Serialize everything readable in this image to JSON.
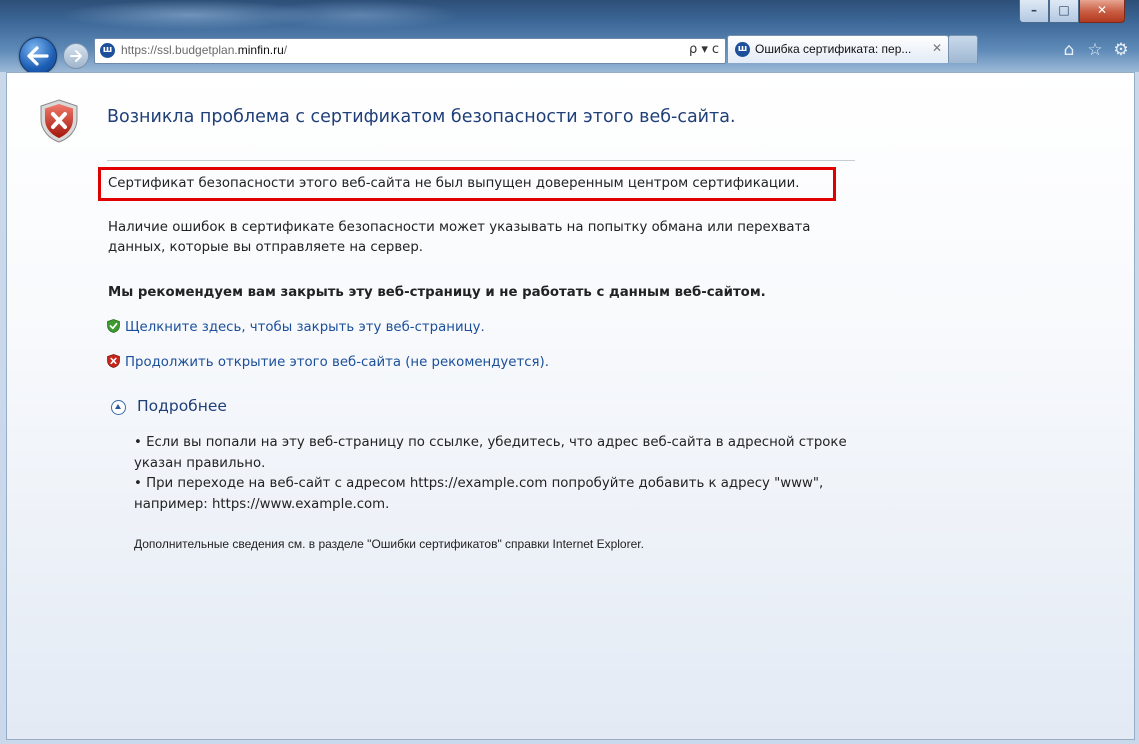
{
  "window": {
    "controls": {
      "minimize": "–",
      "maximize": "□",
      "close": "✕"
    }
  },
  "nav": {
    "url_prefix": "https://ssl.budgetplan.",
    "url_host": "minfin.ru",
    "url_suffix": "/",
    "search_icon": "ρ",
    "dropdown_icon": "▾",
    "refresh_icon": "ᴄ",
    "tab_label": "Ошибка сертификата: пер...",
    "tab_close": "✕",
    "favicon_glyph": "ш"
  },
  "toolbar": {
    "home_icon": "⌂",
    "favorites_icon": "☆",
    "settings_icon": "⚙"
  },
  "page": {
    "heading": "Возникла проблема с сертификатом безопасности этого веб-сайта.",
    "cert_message": "Сертификат безопасности этого веб-сайта не был выпущен доверенным центром сертификации.",
    "warning_text": "Наличие ошибок в сертификате безопасности может указывать на попытку обмана или перехвата данных, которые вы отправляете на сервер.",
    "recommendation": "Мы рекомендуем вам закрыть эту веб-страницу и не работать с данным веб-сайтом.",
    "close_link": "Щелкните здесь, чтобы закрыть эту веб-страницу.",
    "continue_link": "Продолжить открытие этого веб-сайта (не рекомендуется).",
    "details_label": "Подробнее",
    "bullets": [
      "•   Если вы попали на эту веб-страницу по ссылке, убедитесь, что адрес веб-сайта в адресной строке указан правильно.",
      "•   При переходе на веб-сайт с адресом https://example.com попробуйте добавить к адресу \"www\", например: https://www.example.com."
    ],
    "footnote": "Дополнительные сведения см. в разделе \"Ошибки сертификатов\" справки Internet Explorer."
  },
  "colors": {
    "accent_link": "#1b4f9a",
    "heading": "#1f3f79",
    "highlight_box": "#e00000"
  },
  "icons": {
    "page_icon": "shield-error-icon",
    "close_link_icon": "shield-check-icon",
    "continue_link_icon": "shield-error-icon",
    "details_icon": "collapse-circle-icon"
  }
}
